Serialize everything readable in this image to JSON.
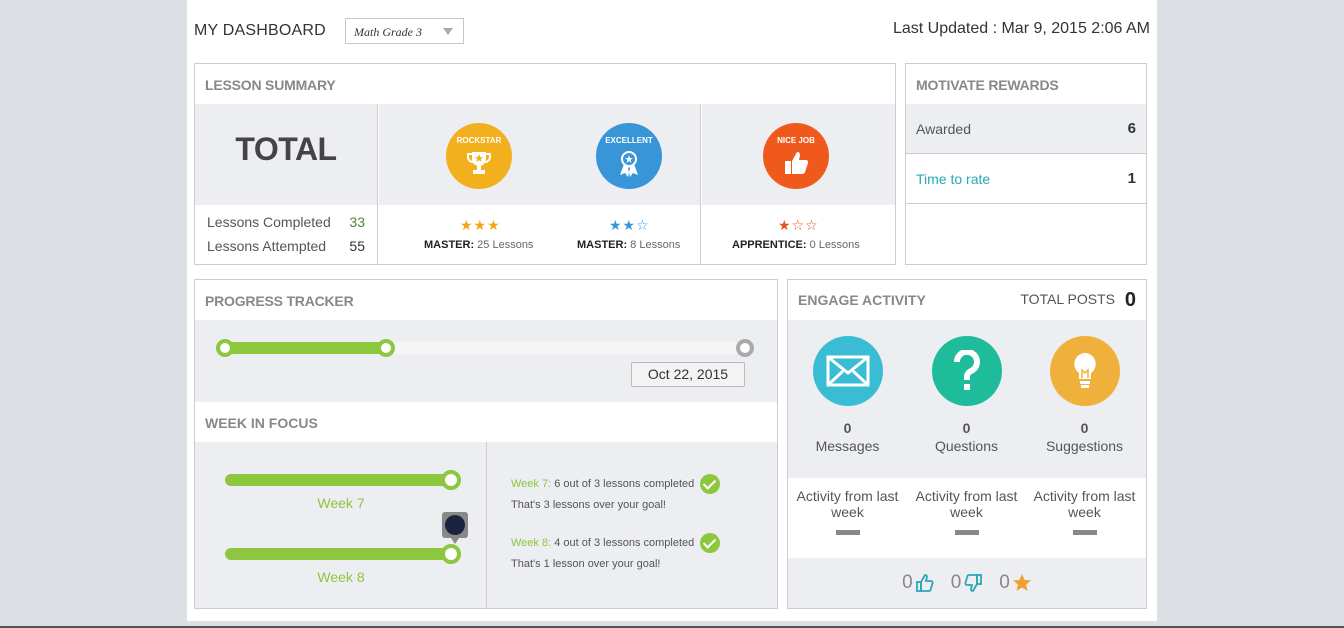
{
  "header": {
    "title": "MY DASHBOARD",
    "grade_select": "Math Grade 3",
    "last_updated": "Last Updated : Mar 9, 2015 2:06 AM"
  },
  "lesson_summary": {
    "title": "LESSON SUMMARY",
    "total_label": "TOTAL",
    "completed_label": "Lessons Completed",
    "completed_value": "33",
    "attempted_label": "Lessons Attempted",
    "attempted_value": "55",
    "badges": [
      {
        "name": "ROCKSTAR",
        "color": "#f2b01e",
        "stars": "★★★",
        "star_color": "#f2a51a",
        "level": "MASTER:",
        "lessons": "25 Lessons"
      },
      {
        "name": "EXCELLENT",
        "color": "#3896d8",
        "stars": "★★☆",
        "star_color": "#3896d8",
        "level": "MASTER:",
        "lessons": "8 Lessons"
      },
      {
        "name": "NICE JOB",
        "color": "#ef5a1c",
        "stars": "★☆☆",
        "star_color": "#e5531a",
        "level": "APPRENTICE:",
        "lessons": "0 Lessons"
      }
    ]
  },
  "motivate_rewards": {
    "title": "MOTIVATE REWARDS",
    "rows": [
      {
        "label": "Awarded",
        "value": "6"
      },
      {
        "label": "Time to rate",
        "value": "1"
      }
    ]
  },
  "progress_tracker": {
    "title": "PROGRESS TRACKER",
    "progress": 0.31,
    "date": "Oct 22, 2015"
  },
  "week_in_focus": {
    "title": "WEEK IN FOCUS",
    "weeks": [
      {
        "label": "Week 7",
        "prefix": "Week 7:",
        "summary": "6 out of 3 lessons completed",
        "note": "That's 3 lessons over your goal!"
      },
      {
        "label": "Week 8",
        "prefix": "Week 8:",
        "summary": "4 out of 3 lessons completed",
        "note": "That's 1 lesson over your goal!"
      }
    ]
  },
  "engage_activity": {
    "title": "ENGAGE ACTIVITY",
    "total_posts_label": "TOTAL POSTS",
    "total_posts": "0",
    "items": [
      {
        "count": "0",
        "label": "Messages",
        "color": "#3bbcd5",
        "icon": "envelope-icon"
      },
      {
        "count": "0",
        "label": "Questions",
        "color": "#1fbc9c",
        "icon": "question-icon"
      },
      {
        "count": "0",
        "label": "Suggestions",
        "color": "#f0b03c",
        "icon": "lightbulb-icon"
      }
    ],
    "activity_label": "Activity from last week",
    "footer": {
      "likes": "0",
      "dislikes": "0",
      "stars": "0"
    }
  }
}
